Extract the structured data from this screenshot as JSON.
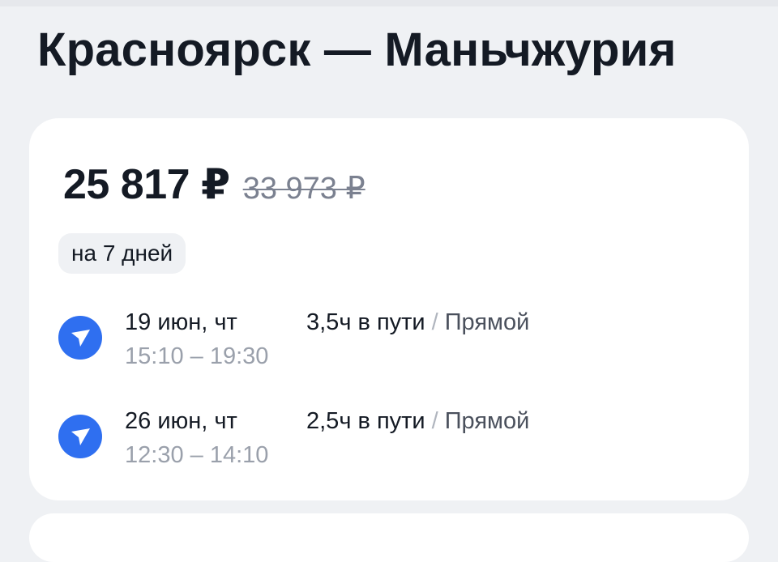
{
  "header": {
    "title": "Красноярск — Маньчжурия"
  },
  "offer": {
    "price_current": "25 817 ₽",
    "price_old": "33 973 ₽",
    "duration_badge": "на 7 дней"
  },
  "flights": [
    {
      "date": "19 июн, чт",
      "times": "15:10 – 19:30",
      "travel_time": "3,5ч в пути",
      "separator": "/",
      "type": "Прямой",
      "icon": "plane-icon"
    },
    {
      "date": "26 июн, чт",
      "times": "12:30 – 14:10",
      "travel_time": "2,5ч в пути",
      "separator": "/",
      "type": "Прямой",
      "icon": "plane-icon"
    }
  ],
  "colors": {
    "background": "#eff1f4",
    "card": "#ffffff",
    "accent": "#2f6ff0",
    "text": "#141a24",
    "muted": "#9aa0ab"
  }
}
